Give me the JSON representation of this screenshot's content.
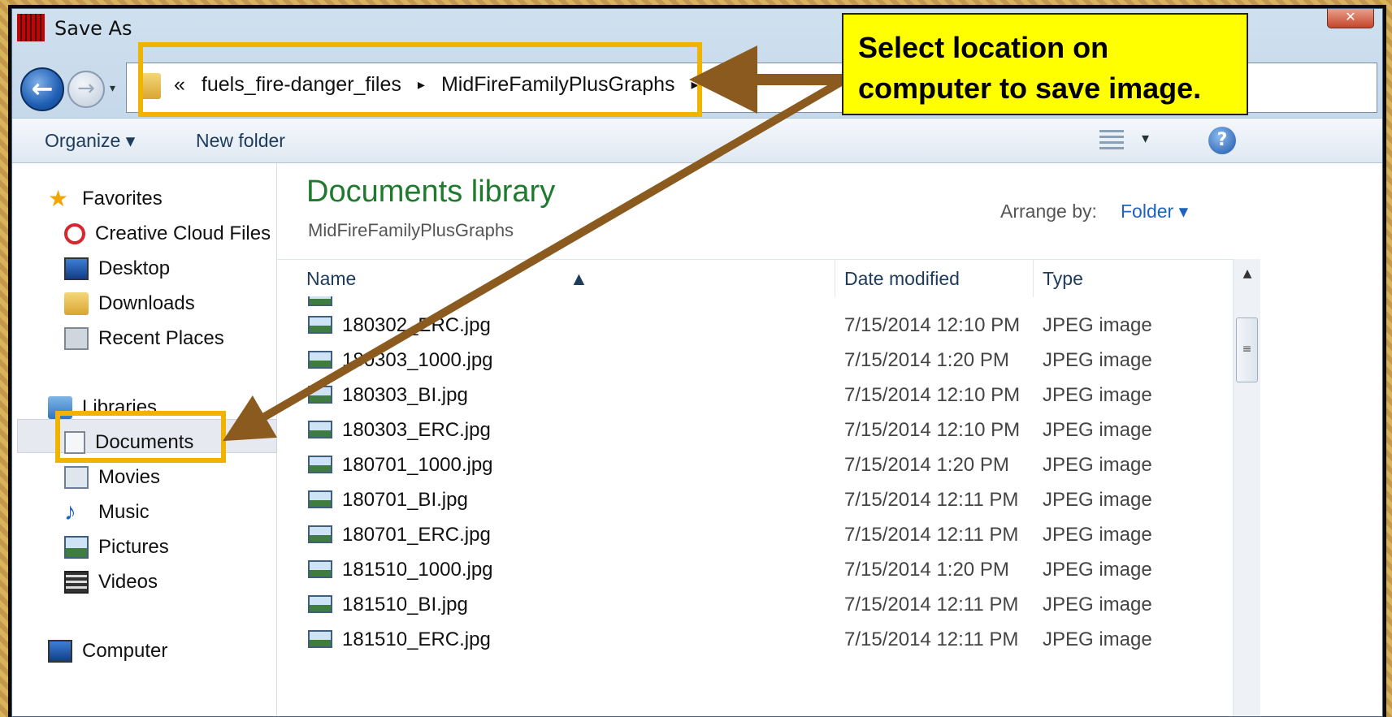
{
  "window": {
    "title": "Save As",
    "close_label": "✕"
  },
  "address_bar": {
    "overflow": "«",
    "crumbs": [
      "fuels_fire-danger_files",
      "MidFireFamilyPlusGraphs"
    ],
    "separator": "▸"
  },
  "toolbar": {
    "organize_label": "Organize ▾",
    "new_folder_label": "New folder",
    "view_dropdown": "▾",
    "help": "?"
  },
  "sidebar": {
    "favorites": {
      "header": "Favorites",
      "items": [
        "Creative Cloud Files",
        "Desktop",
        "Downloads",
        "Recent Places"
      ]
    },
    "libraries": {
      "header": "Libraries",
      "items": [
        "Documents",
        "Movies",
        "Music",
        "Pictures",
        "Videos"
      ]
    },
    "computer": "Computer"
  },
  "main": {
    "title": "Documents library",
    "subtitle": "MidFireFamilyPlusGraphs",
    "arrange_label": "Arrange by:",
    "arrange_value": "Folder ▾",
    "columns": {
      "name": "Name",
      "date": "Date modified",
      "type": "Type"
    },
    "files": [
      {
        "name": "180302_ERC.jpg",
        "date": "7/15/2014 12:10 PM",
        "type": "JPEG image"
      },
      {
        "name": "180303_1000.jpg",
        "date": "7/15/2014 1:20 PM",
        "type": "JPEG image"
      },
      {
        "name": "180303_BI.jpg",
        "date": "7/15/2014 12:10 PM",
        "type": "JPEG image"
      },
      {
        "name": "180303_ERC.jpg",
        "date": "7/15/2014 12:10 PM",
        "type": "JPEG image"
      },
      {
        "name": "180701_1000.jpg",
        "date": "7/15/2014 1:20 PM",
        "type": "JPEG image"
      },
      {
        "name": "180701_BI.jpg",
        "date": "7/15/2014 12:11 PM",
        "type": "JPEG image"
      },
      {
        "name": "180701_ERC.jpg",
        "date": "7/15/2014 12:11 PM",
        "type": "JPEG image"
      },
      {
        "name": "181510_1000.jpg",
        "date": "7/15/2014 1:20 PM",
        "type": "JPEG image"
      },
      {
        "name": "181510_BI.jpg",
        "date": "7/15/2014 12:11 PM",
        "type": "JPEG image"
      },
      {
        "name": "181510_ERC.jpg",
        "date": "7/15/2014 12:11 PM",
        "type": "JPEG image"
      }
    ]
  },
  "annotation": {
    "callout_text": "Select location on computer to save image."
  },
  "colors": {
    "highlight": "#f0b400",
    "arrow": "#8b5a1e",
    "callout_bg": "#ffff00",
    "library_title": "#1f7a2e"
  }
}
